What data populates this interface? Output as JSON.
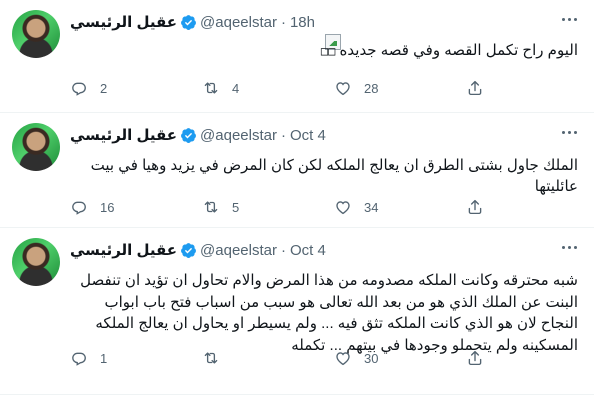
{
  "tweets": [
    {
      "name": "عقيل الرئيسي",
      "handle": "@aqeelstar",
      "separator": "·",
      "time": "18h",
      "text": "اليوم راح تكمل القصه وفي قصه جديده",
      "trailing": "□□",
      "replies": "2",
      "retweets": "4",
      "likes": "28"
    },
    {
      "name": "عقيل الرئيسي",
      "handle": "@aqeelstar",
      "separator": "·",
      "time": "Oct 4",
      "text": "الملك جاول بشتى الطرق ان يعالج الملكه لكن كان المرض في يزيد وهيا في بيت عائليتها",
      "replies": "16",
      "retweets": "5",
      "likes": "34"
    },
    {
      "name": "عقيل الرئيسي",
      "handle": "@aqeelstar",
      "separator": "·",
      "time": "Oct 4",
      "text": "شبه محترقه وكانت الملكه مصدومه من هذا المرض والام تحاول ان تؤيد ان تنفصل البنت عن الملك الذي هو من بعد الله تعالى هو سبب من اسباب فتح باب ابواب النجاح لان هو الذي كانت الملكه تثق فيه ... ولم يسيطر او يحاول ان يعالج الملكه المسكينه ولم يتحملو وجودها في بيتهم ... تكمله",
      "replies": "1",
      "retweets": "",
      "likes": "30"
    }
  ],
  "icons": {
    "verified": "verified-badge-icon",
    "reply": "reply-icon",
    "retweet": "retweet-icon",
    "like": "heart-icon",
    "share": "share-icon",
    "more": "more-options-icon"
  },
  "colors": {
    "verified": "#1d9bf0",
    "meta": "#536471",
    "divider": "#eff3f4"
  }
}
